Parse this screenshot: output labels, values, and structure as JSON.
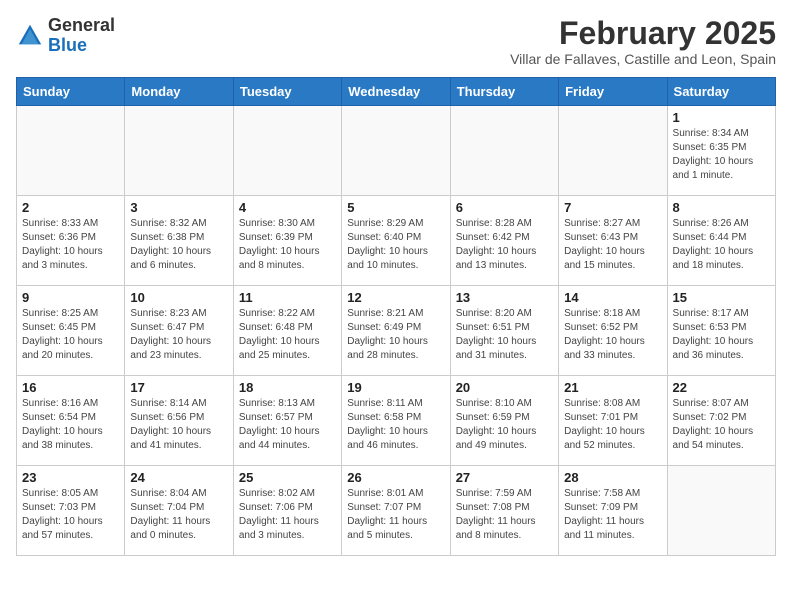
{
  "logo": {
    "general": "General",
    "blue": "Blue"
  },
  "title": "February 2025",
  "subtitle": "Villar de Fallaves, Castille and Leon, Spain",
  "days_header": [
    "Sunday",
    "Monday",
    "Tuesday",
    "Wednesday",
    "Thursday",
    "Friday",
    "Saturday"
  ],
  "weeks": [
    [
      {
        "day": "",
        "info": ""
      },
      {
        "day": "",
        "info": ""
      },
      {
        "day": "",
        "info": ""
      },
      {
        "day": "",
        "info": ""
      },
      {
        "day": "",
        "info": ""
      },
      {
        "day": "",
        "info": ""
      },
      {
        "day": "1",
        "info": "Sunrise: 8:34 AM\nSunset: 6:35 PM\nDaylight: 10 hours and 1 minute."
      }
    ],
    [
      {
        "day": "2",
        "info": "Sunrise: 8:33 AM\nSunset: 6:36 PM\nDaylight: 10 hours and 3 minutes."
      },
      {
        "day": "3",
        "info": "Sunrise: 8:32 AM\nSunset: 6:38 PM\nDaylight: 10 hours and 6 minutes."
      },
      {
        "day": "4",
        "info": "Sunrise: 8:30 AM\nSunset: 6:39 PM\nDaylight: 10 hours and 8 minutes."
      },
      {
        "day": "5",
        "info": "Sunrise: 8:29 AM\nSunset: 6:40 PM\nDaylight: 10 hours and 10 minutes."
      },
      {
        "day": "6",
        "info": "Sunrise: 8:28 AM\nSunset: 6:42 PM\nDaylight: 10 hours and 13 minutes."
      },
      {
        "day": "7",
        "info": "Sunrise: 8:27 AM\nSunset: 6:43 PM\nDaylight: 10 hours and 15 minutes."
      },
      {
        "day": "8",
        "info": "Sunrise: 8:26 AM\nSunset: 6:44 PM\nDaylight: 10 hours and 18 minutes."
      }
    ],
    [
      {
        "day": "9",
        "info": "Sunrise: 8:25 AM\nSunset: 6:45 PM\nDaylight: 10 hours and 20 minutes."
      },
      {
        "day": "10",
        "info": "Sunrise: 8:23 AM\nSunset: 6:47 PM\nDaylight: 10 hours and 23 minutes."
      },
      {
        "day": "11",
        "info": "Sunrise: 8:22 AM\nSunset: 6:48 PM\nDaylight: 10 hours and 25 minutes."
      },
      {
        "day": "12",
        "info": "Sunrise: 8:21 AM\nSunset: 6:49 PM\nDaylight: 10 hours and 28 minutes."
      },
      {
        "day": "13",
        "info": "Sunrise: 8:20 AM\nSunset: 6:51 PM\nDaylight: 10 hours and 31 minutes."
      },
      {
        "day": "14",
        "info": "Sunrise: 8:18 AM\nSunset: 6:52 PM\nDaylight: 10 hours and 33 minutes."
      },
      {
        "day": "15",
        "info": "Sunrise: 8:17 AM\nSunset: 6:53 PM\nDaylight: 10 hours and 36 minutes."
      }
    ],
    [
      {
        "day": "16",
        "info": "Sunrise: 8:16 AM\nSunset: 6:54 PM\nDaylight: 10 hours and 38 minutes."
      },
      {
        "day": "17",
        "info": "Sunrise: 8:14 AM\nSunset: 6:56 PM\nDaylight: 10 hours and 41 minutes."
      },
      {
        "day": "18",
        "info": "Sunrise: 8:13 AM\nSunset: 6:57 PM\nDaylight: 10 hours and 44 minutes."
      },
      {
        "day": "19",
        "info": "Sunrise: 8:11 AM\nSunset: 6:58 PM\nDaylight: 10 hours and 46 minutes."
      },
      {
        "day": "20",
        "info": "Sunrise: 8:10 AM\nSunset: 6:59 PM\nDaylight: 10 hours and 49 minutes."
      },
      {
        "day": "21",
        "info": "Sunrise: 8:08 AM\nSunset: 7:01 PM\nDaylight: 10 hours and 52 minutes."
      },
      {
        "day": "22",
        "info": "Sunrise: 8:07 AM\nSunset: 7:02 PM\nDaylight: 10 hours and 54 minutes."
      }
    ],
    [
      {
        "day": "23",
        "info": "Sunrise: 8:05 AM\nSunset: 7:03 PM\nDaylight: 10 hours and 57 minutes."
      },
      {
        "day": "24",
        "info": "Sunrise: 8:04 AM\nSunset: 7:04 PM\nDaylight: 11 hours and 0 minutes."
      },
      {
        "day": "25",
        "info": "Sunrise: 8:02 AM\nSunset: 7:06 PM\nDaylight: 11 hours and 3 minutes."
      },
      {
        "day": "26",
        "info": "Sunrise: 8:01 AM\nSunset: 7:07 PM\nDaylight: 11 hours and 5 minutes."
      },
      {
        "day": "27",
        "info": "Sunrise: 7:59 AM\nSunset: 7:08 PM\nDaylight: 11 hours and 8 minutes."
      },
      {
        "day": "28",
        "info": "Sunrise: 7:58 AM\nSunset: 7:09 PM\nDaylight: 11 hours and 11 minutes."
      },
      {
        "day": "",
        "info": ""
      }
    ]
  ]
}
